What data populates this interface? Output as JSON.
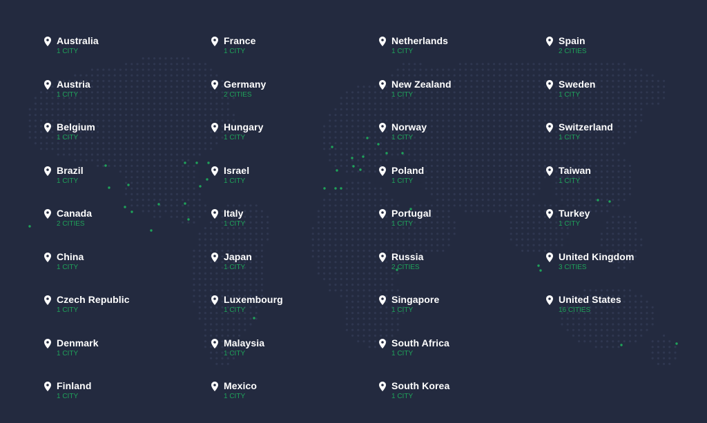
{
  "colors": {
    "background": "#232a3f",
    "dot": "#2f3750",
    "dot_active": "#1fa35a",
    "country_text": "#ffffff",
    "city_text": "#1fa35a"
  },
  "icon": "map-pin-icon",
  "columns": [
    [
      {
        "country": "Australia",
        "cities": "1 CITY"
      },
      {
        "country": "Austria",
        "cities": "1 CITY"
      },
      {
        "country": "Belgium",
        "cities": "1 CITY"
      },
      {
        "country": "Brazil",
        "cities": "1 CITY"
      },
      {
        "country": "Canada",
        "cities": "2 CITIES"
      },
      {
        "country": "China",
        "cities": "1 CITY"
      },
      {
        "country": "Czech Republic",
        "cities": "1 CITY"
      },
      {
        "country": "Denmark",
        "cities": "1 CITY"
      },
      {
        "country": "Finland",
        "cities": "1 CITY"
      }
    ],
    [
      {
        "country": "France",
        "cities": "1 CITY"
      },
      {
        "country": "Germany",
        "cities": "2 CITIES"
      },
      {
        "country": "Hungary",
        "cities": "1 CITY"
      },
      {
        "country": "Israel",
        "cities": "1 CITY"
      },
      {
        "country": "Italy",
        "cities": "1 CITY"
      },
      {
        "country": "Japan",
        "cities": "1 CITY"
      },
      {
        "country": "Luxembourg",
        "cities": "1 CITY"
      },
      {
        "country": "Malaysia",
        "cities": "1 CITY"
      },
      {
        "country": "Mexico",
        "cities": "1 CITY"
      }
    ],
    [
      {
        "country": "Netherlands",
        "cities": "1 CITY"
      },
      {
        "country": "New Zealand",
        "cities": "1 CITY"
      },
      {
        "country": "Norway",
        "cities": "1 CITY"
      },
      {
        "country": "Poland",
        "cities": "1 CITY"
      },
      {
        "country": "Portugal",
        "cities": "1 CITY"
      },
      {
        "country": "Russia",
        "cities": "2 CITIES"
      },
      {
        "country": "Singapore",
        "cities": "1 CITY"
      },
      {
        "country": "South Africa",
        "cities": "1 CITY"
      },
      {
        "country": "South Korea",
        "cities": "1 CITY"
      }
    ],
    [
      {
        "country": "Spain",
        "cities": "2 CITIES"
      },
      {
        "country": "Sweden",
        "cities": "1 CITY"
      },
      {
        "country": "Switzerland",
        "cities": "1 CITY"
      },
      {
        "country": "Taiwan",
        "cities": "1 CITY"
      },
      {
        "country": "Turkey",
        "cities": "1 CITY"
      },
      {
        "country": "United Kingdom",
        "cities": "3 CITIES"
      },
      {
        "country": "United States",
        "cities": "16 CITIES"
      }
    ]
  ]
}
